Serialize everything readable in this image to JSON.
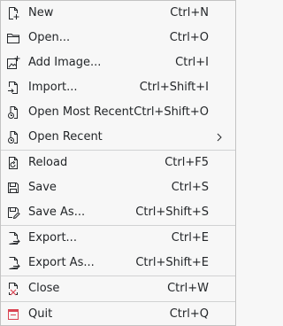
{
  "menu": {
    "items": [
      {
        "label": "New",
        "shortcut": "Ctrl+N",
        "icon": "document-new-icon"
      },
      {
        "label": "Open...",
        "shortcut": "Ctrl+O",
        "icon": "folder-open-icon"
      },
      {
        "label": "Add Image...",
        "shortcut": "Ctrl+I",
        "icon": "add-image-icon"
      },
      {
        "label": "Import...",
        "shortcut": "Ctrl+Shift+I",
        "icon": "document-import-icon"
      },
      {
        "label": "Open Most Recent",
        "shortcut": "Ctrl+Shift+O",
        "icon": "document-recent-icon"
      },
      {
        "label": "Open Recent",
        "shortcut": "",
        "icon": "document-recent-icon"
      },
      {
        "label": "Reload",
        "shortcut": "Ctrl+F5",
        "icon": "document-revert-icon"
      },
      {
        "label": "Save",
        "shortcut": "Ctrl+S",
        "icon": "document-save-icon"
      },
      {
        "label": "Save As...",
        "shortcut": "Ctrl+Shift+S",
        "icon": "document-save-as-icon"
      },
      {
        "label": "Export...",
        "shortcut": "Ctrl+E",
        "icon": "document-export-icon"
      },
      {
        "label": "Export As...",
        "shortcut": "Ctrl+Shift+E",
        "icon": "document-export-icon"
      },
      {
        "label": "Close",
        "shortcut": "Ctrl+W",
        "icon": "document-close-icon"
      },
      {
        "label": "Quit",
        "shortcut": "Ctrl+Q",
        "icon": "application-exit-icon"
      }
    ],
    "submenu_arrow_icon": "chevron-right-icon",
    "colors": {
      "background": "#f7f7f7",
      "text": "#232629",
      "icon": "#232629",
      "close_accent": "#da4453",
      "separator": "#d1d2d3"
    }
  }
}
